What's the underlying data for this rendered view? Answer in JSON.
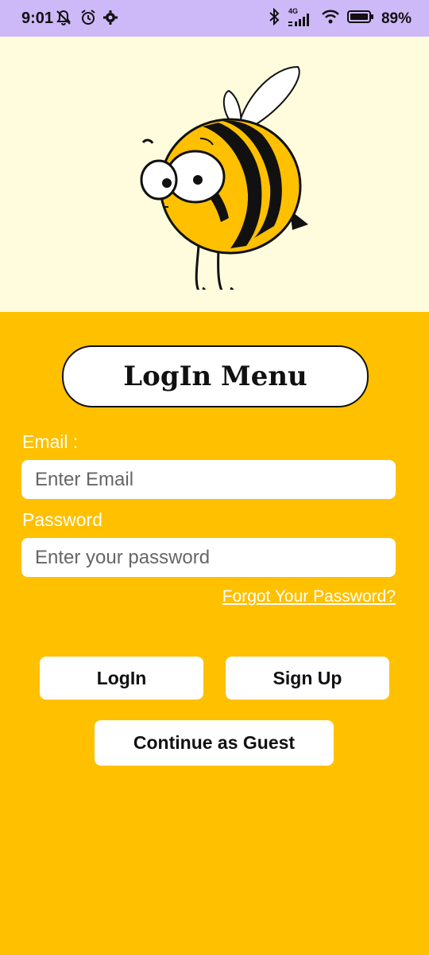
{
  "status_bar": {
    "time": "9:01",
    "network": "4G",
    "battery": "89%"
  },
  "login": {
    "title": "LogIn Menu",
    "email_label": "Email :",
    "email_placeholder": "Enter Email",
    "password_label": "Password",
    "password_placeholder": "Enter your password",
    "forgot_link": "Forgot Your Password?",
    "login_button": "LogIn",
    "signup_button": "Sign Up",
    "guest_button": "Continue as Guest"
  },
  "colors": {
    "status_bar": "#CDB8F8",
    "hero_bg": "#FFFCDD",
    "main_bg": "#FFC000",
    "button_bg": "#FFFFFF"
  },
  "icons": [
    "muted-notification-icon",
    "alarm-icon",
    "settings-icon",
    "bluetooth-icon",
    "signal-icon",
    "wifi-icon",
    "battery-icon"
  ]
}
